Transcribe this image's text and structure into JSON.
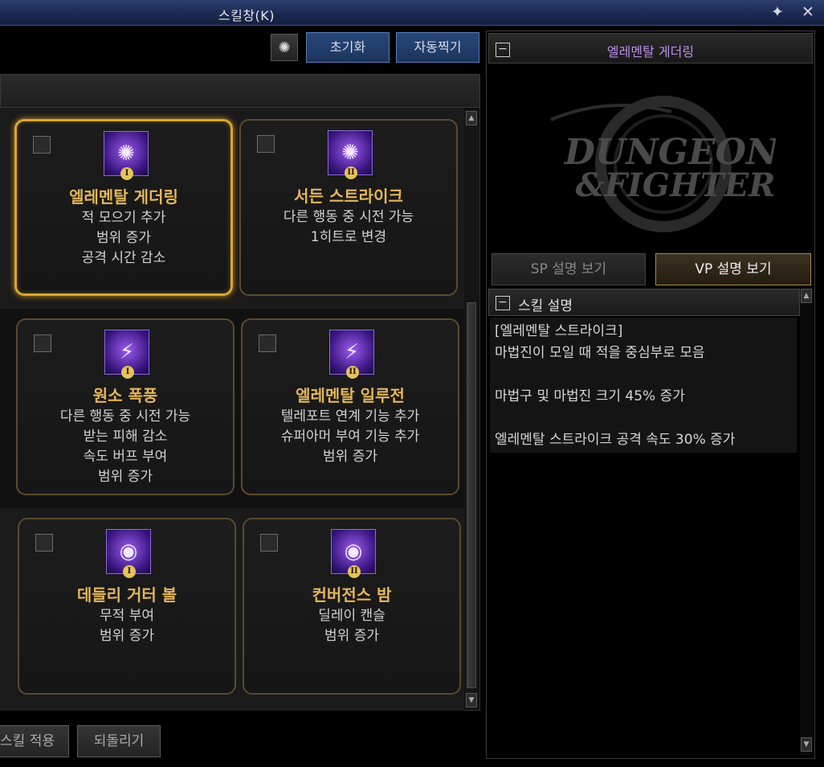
{
  "window": {
    "title": "스킬창(K)",
    "pin_glyph": "📌",
    "close_glyph": "✕"
  },
  "toolbar": {
    "reset_label": "초기화",
    "auto_label": "자동찍기"
  },
  "skills": [
    {
      "name": "엘레멘탈 게더링",
      "lines": [
        "적 모으기 추가",
        "범위 증가",
        "공격 시간 감소"
      ],
      "tier": "I",
      "selected": true
    },
    {
      "name": "서든 스트라이크",
      "lines": [
        "다른 행동 중 시전 가능",
        "1히트로 변경"
      ],
      "tier": "II",
      "selected": false
    },
    {
      "name": "원소 폭풍",
      "lines": [
        "다른 행동 중 시전 가능",
        "받는 피해 감소",
        "속도 버프 부여",
        "범위 증가"
      ],
      "tier": "I",
      "selected": false
    },
    {
      "name": "엘레멘탈 일루전",
      "lines": [
        "텔레포트 연계 기능 추가",
        "슈퍼아머 부여 기능 추가",
        "범위 증가"
      ],
      "tier": "II",
      "selected": false
    },
    {
      "name": "데들리 거터 볼",
      "lines": [
        "무적 부여",
        "범위 증가"
      ],
      "tier": "I",
      "selected": false
    },
    {
      "name": "컨버전스 밤",
      "lines": [
        "딜레이 캔슬",
        "범위 증가"
      ],
      "tier": "II",
      "selected": false
    }
  ],
  "bottom": {
    "apply_label": "스킬 적용",
    "revert_label": "되돌리기"
  },
  "right_panel": {
    "title": "엘레멘탈 게더링",
    "logo_text_1": "DUNGEON",
    "logo_text_2": "&FIGHTER",
    "tab_sp": "SP 설명 보기",
    "tab_vp": "VP 설명 보기",
    "section_label": "스킬 설명",
    "description_lines": [
      "[엘레멘탈 스트라이크]",
      "마법진이 모일 때 적을 중심부로 모음",
      "",
      "마법구 및 마법진 크기 45% 증가",
      "",
      "엘레멘탈 스트라이크 공격 속도 30% 증가"
    ]
  },
  "colors": {
    "accent_gold": "#e3b65a",
    "accent_purple": "#b98ee8",
    "selected_border": "#d9a634"
  }
}
